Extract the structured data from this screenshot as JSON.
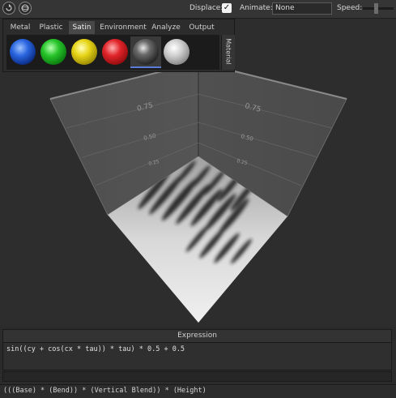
{
  "toolbar": {
    "displace_label": "Displace:",
    "displace_checked": "✓",
    "animate_label": "Animate:",
    "animate_value": "None",
    "speed_label": "Speed:",
    "speed_value": 0.4
  },
  "material_panel": {
    "tabs": [
      "Metal",
      "Plastic",
      "Satin",
      "Environment",
      "Analyze",
      "Output"
    ],
    "active_tab": "Satin",
    "side_label": "Material",
    "swatches": [
      "blue",
      "green",
      "yellow",
      "red",
      "dark-grey",
      "silver"
    ],
    "selected_swatch": "dark-grey"
  },
  "viewport": {
    "wall_labels_left": [
      "0.75",
      "0.50",
      "0.25"
    ],
    "wall_labels_right": [
      "0.75",
      "0.50",
      "0.25"
    ]
  },
  "expression": {
    "header": "Expression",
    "text": "sin((cy + cos(cx * tau)) * tau) * 0.5 + 0.5"
  },
  "status": {
    "text": "(((Base) * (Bend)) * (Vertical Blend)) * (Height)"
  }
}
